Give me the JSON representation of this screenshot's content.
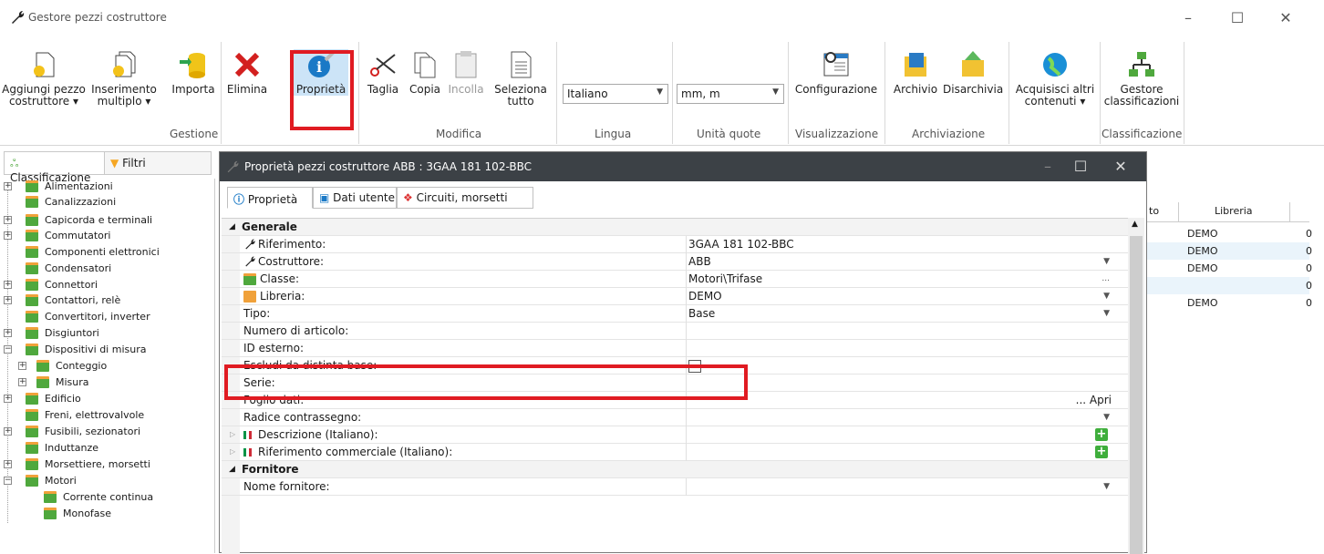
{
  "window": {
    "title": "Gestore pezzi costruttore"
  },
  "ribbon": {
    "buttons": {
      "aggiungi": "Aggiungi pezzo\ncostruttore ▾",
      "inserimento": "Inserimento\nmultiplo ▾",
      "importa": "Importa",
      "elimina": "Elimina",
      "proprieta": "Proprietà",
      "taglia": "Taglia",
      "copia": "Copia",
      "incolla": "Incolla",
      "seleziona": "Seleziona\ntutto",
      "configurazione": "Configurazione",
      "archivio": "Archivio",
      "disarchivia": "Disarchivia",
      "acquisisci": "Acquisisci altri\ncontenuti ▾",
      "gestore": "Gestore\nclassificazioni"
    },
    "combos": {
      "lingua": "Italiano",
      "unita": "mm, m"
    },
    "groups": {
      "gestione": "Gestione",
      "modifica": "Modifica",
      "lingua": "Lingua",
      "unita": "Unità quote",
      "visualizzazione": "Visualizzazione",
      "archiviazione": "Archiviazione",
      "classificazione": "Classificazione"
    }
  },
  "left_tabs": {
    "classificazione": "Classificazione",
    "filtri": "Filtri"
  },
  "tree": [
    "Alimentazioni",
    "Canalizzazioni",
    "Capicorda e terminali",
    "Commutatori",
    "Componenti elettronici",
    "Condensatori",
    "Connettori",
    "Contattori, relè",
    "Convertitori, inverter",
    "Disgiuntori",
    "Dispositivi di misura",
    "Conteggio",
    "Misura",
    "Edificio",
    "Freni, elettrovalvole",
    "Fusibili, sezionatori",
    "Induttanze",
    "Morsettiere, morsetti",
    "Motori",
    "Corrente continua",
    "Monofase"
  ],
  "bg_list": {
    "col_partial": "to",
    "col_libreria": "Libreria",
    "rows": [
      {
        "lib": "DEMO",
        "n": "0"
      },
      {
        "lib": "DEMO",
        "n": "0"
      },
      {
        "lib": "DEMO",
        "n": "0"
      },
      {
        "lib": "",
        "n": "0"
      },
      {
        "lib": "DEMO",
        "n": "0"
      }
    ]
  },
  "dialog": {
    "title": "Proprietà pezzi costruttore ABB : 3GAA 181 102-BBC",
    "tabs": {
      "proprieta": "Proprietà",
      "dati_utente": "Dati utente",
      "circuiti": "Circuiti, morsetti"
    },
    "rows": {
      "generale": "Generale",
      "riferimento_k": "Riferimento:",
      "riferimento_v": "3GAA 181 102-BBC",
      "costruttore_k": "Costruttore:",
      "costruttore_v": "ABB",
      "classe_k": "Classe:",
      "classe_v": "Motori\\Trifase",
      "classe_more": "...",
      "libreria_k": "Libreria:",
      "libreria_v": "DEMO",
      "tipo_k": "Tipo:",
      "tipo_v": "Base",
      "numero_k": "Numero di articolo:",
      "idesterno_k": "ID esterno:",
      "escludi_k": "Escludi da distinta base:",
      "serie_k": "Serie:",
      "foglio_k": "Foglio dati:",
      "foglio_v": "... Apri",
      "radice_k": "Radice contrassegno:",
      "descrizione_k": "Descrizione (Italiano):",
      "rifcomm_k": "Riferimento commerciale (Italiano):",
      "fornitore": "Fornitore",
      "nomefornitore_k": "Nome fornitore:"
    }
  },
  "colors": {
    "highlight": "#e01b22",
    "dialog_title_bg": "#3c4146",
    "folder_green": "#4fa83d"
  }
}
